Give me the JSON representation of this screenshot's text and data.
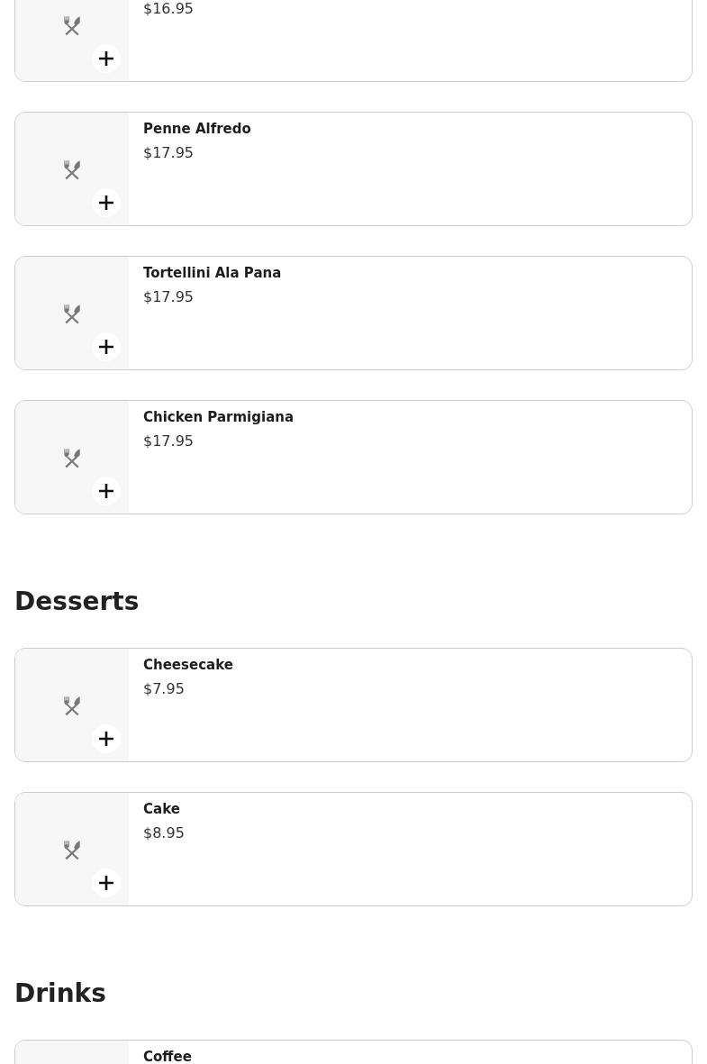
{
  "sections": [
    {
      "items": [
        {
          "price": "$16.95"
        },
        {
          "name": "Penne Alfredo",
          "price": "$17.95"
        },
        {
          "name": "Tortellini Ala Pana",
          "price": "$17.95"
        },
        {
          "name": "Chicken Parmigiana",
          "price": "$17.95"
        }
      ]
    },
    {
      "heading": "Desserts",
      "items": [
        {
          "name": "Cheesecake",
          "price": "$7.95"
        },
        {
          "name": "Cake",
          "price": "$8.95"
        }
      ]
    },
    {
      "heading": "Drinks",
      "items": [
        {
          "name": "Coffee"
        }
      ]
    }
  ]
}
